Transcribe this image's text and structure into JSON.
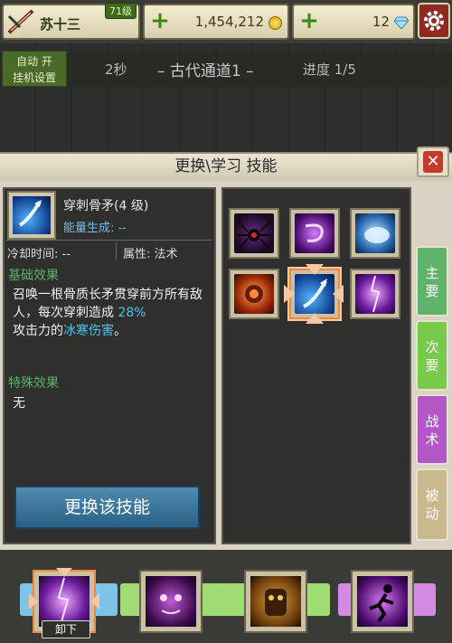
{
  "player": {
    "name": "苏十三",
    "level": "71级"
  },
  "currency": {
    "gold": "1,454,212",
    "gems": "12"
  },
  "stage": {
    "auto_label_1": "自动 开",
    "auto_label_2": "挂机设置",
    "time": "2秒",
    "name": "– 古代通道1 –",
    "progress": "进度 1/5"
  },
  "panel": {
    "title": "更换\\学习  技能"
  },
  "skill": {
    "name": "穿刺骨矛",
    "level": "(4 级)",
    "energy": "能量生成: --",
    "cooldown": "冷却时间: --",
    "attribute": "属性: 法术",
    "basic_heading": "基础效果",
    "basic_text_1": "召唤一根骨质长矛贯穿前方所有敌人，每次穿刺造成 ",
    "basic_percent": "28%",
    "basic_text_2": "攻击力的",
    "basic_damage": "冰寒伤害",
    "basic_text_3": "。",
    "special_heading": "特殊效果",
    "special_text": "无"
  },
  "buttons": {
    "swap": "更换该技能",
    "unequip": "卸下"
  },
  "tabs": [
    {
      "label_1": "主",
      "label_2": "要"
    },
    {
      "label_1": "次",
      "label_2": "要"
    },
    {
      "label_1": "战",
      "label_2": "术"
    },
    {
      "label_1": "被",
      "label_2": "动"
    }
  ],
  "colors": {
    "accent_blue": "#4fc2ef",
    "heading_green": "#5fb06a",
    "tab_primary": "#5fb36a",
    "tab_secondary": "#79c94a",
    "tab_tactic": "#b356c8",
    "tab_passive": "#c9b98c"
  },
  "skill_grid_icons": [
    "spider-skill-icon",
    "purple-vortex-skill-icon",
    "frost-beast-skill-icon",
    "fire-fist-skill-icon",
    "bone-spear-skill-icon",
    "violet-lightning-skill-icon"
  ],
  "equipped_slot_icons": [
    "violet-lightning-skill-icon",
    "demon-face-skill-icon",
    "golem-skill-icon",
    "shadow-runner-skill-icon"
  ]
}
